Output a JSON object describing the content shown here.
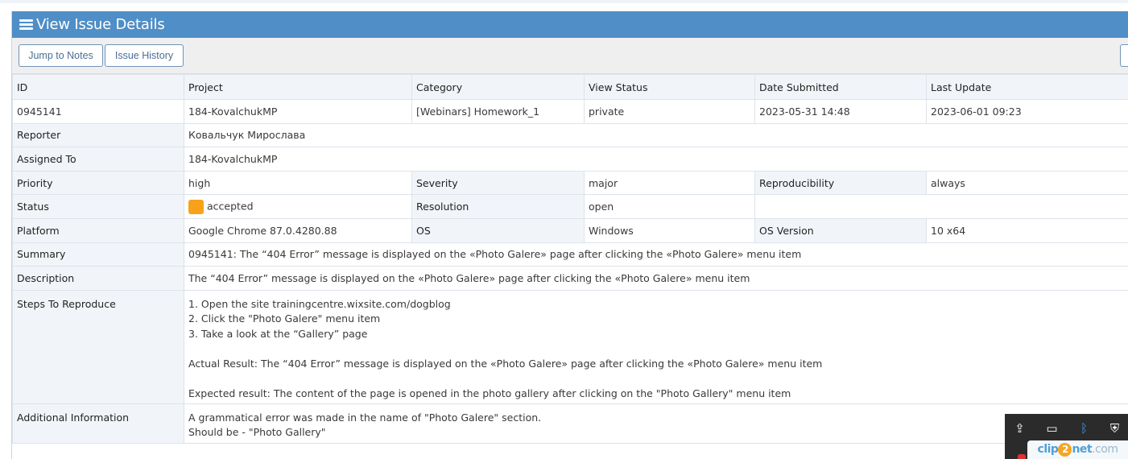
{
  "header": {
    "title": "View Issue Details",
    "menu_icon": "hamburger-icon"
  },
  "toolbar": {
    "jump_to_notes": "Jump to Notes",
    "issue_history": "Issue History"
  },
  "columns": [
    "ID",
    "Project",
    "Category",
    "View Status",
    "Date Submitted",
    "Last Update"
  ],
  "issue": {
    "id": "0945141",
    "project": "184-KovalchukMP",
    "category": "[Webinars] Homework_1",
    "view_status": "private",
    "date_submitted": "2023-05-31 14:48",
    "last_update": "2023-06-01 09:23"
  },
  "labels": {
    "reporter": "Reporter",
    "assigned_to": "Assigned To",
    "priority": "Priority",
    "severity": "Severity",
    "reproducibility": "Reproducibility",
    "status": "Status",
    "resolution": "Resolution",
    "platform": "Platform",
    "os": "OS",
    "os_version": "OS Version",
    "summary": "Summary",
    "description": "Description",
    "steps": "Steps To Reproduce",
    "additional": "Additional Information"
  },
  "values": {
    "reporter": "Ковальчук Мирослава",
    "assigned_to": "184-KovalchukMP",
    "priority": "high",
    "severity": "major",
    "reproducibility": "always",
    "status": "accepted",
    "status_color": "#f7a21a",
    "resolution": "open",
    "platform": "Google Chrome 87.0.4280.88",
    "os": "Windows",
    "os_version": "10 x64",
    "summary": "0945141: The “404 Error” message is displayed on the «Photo Galere» page after clicking the «Photo Galere» menu item",
    "description": "The “404 Error” message is displayed on the «Photo Galere» page after clicking the «Photo Galere» menu item",
    "steps": [
      "1. Open the site trainingcentre.wixsite.com/dogblog",
      "2. Click the \"Photo Galere\" menu item",
      "3. Take a look at the “Gallery” page",
      "",
      "Actual Result: The “404 Error” message is displayed on the «Photo Galere» page after clicking the «Photo Galere» menu item",
      "",
      "Expected result: The content of the page is opened in the photo gallery after clicking on the \"Photo Gallery\" menu item"
    ],
    "additional": [
      "A grammatical error was made in the name of \"Photo Galere\" section.",
      "Should be - \"Photo Gallery\""
    ]
  },
  "tray": {
    "logo_main": "clip",
    "logo_two": "2",
    "logo_net": "net",
    "logo_com": ".com"
  },
  "colors": {
    "header_bg": "#4f8ec6",
    "button_border": "#6f94b8",
    "label_bg": "#f1f5f9"
  }
}
